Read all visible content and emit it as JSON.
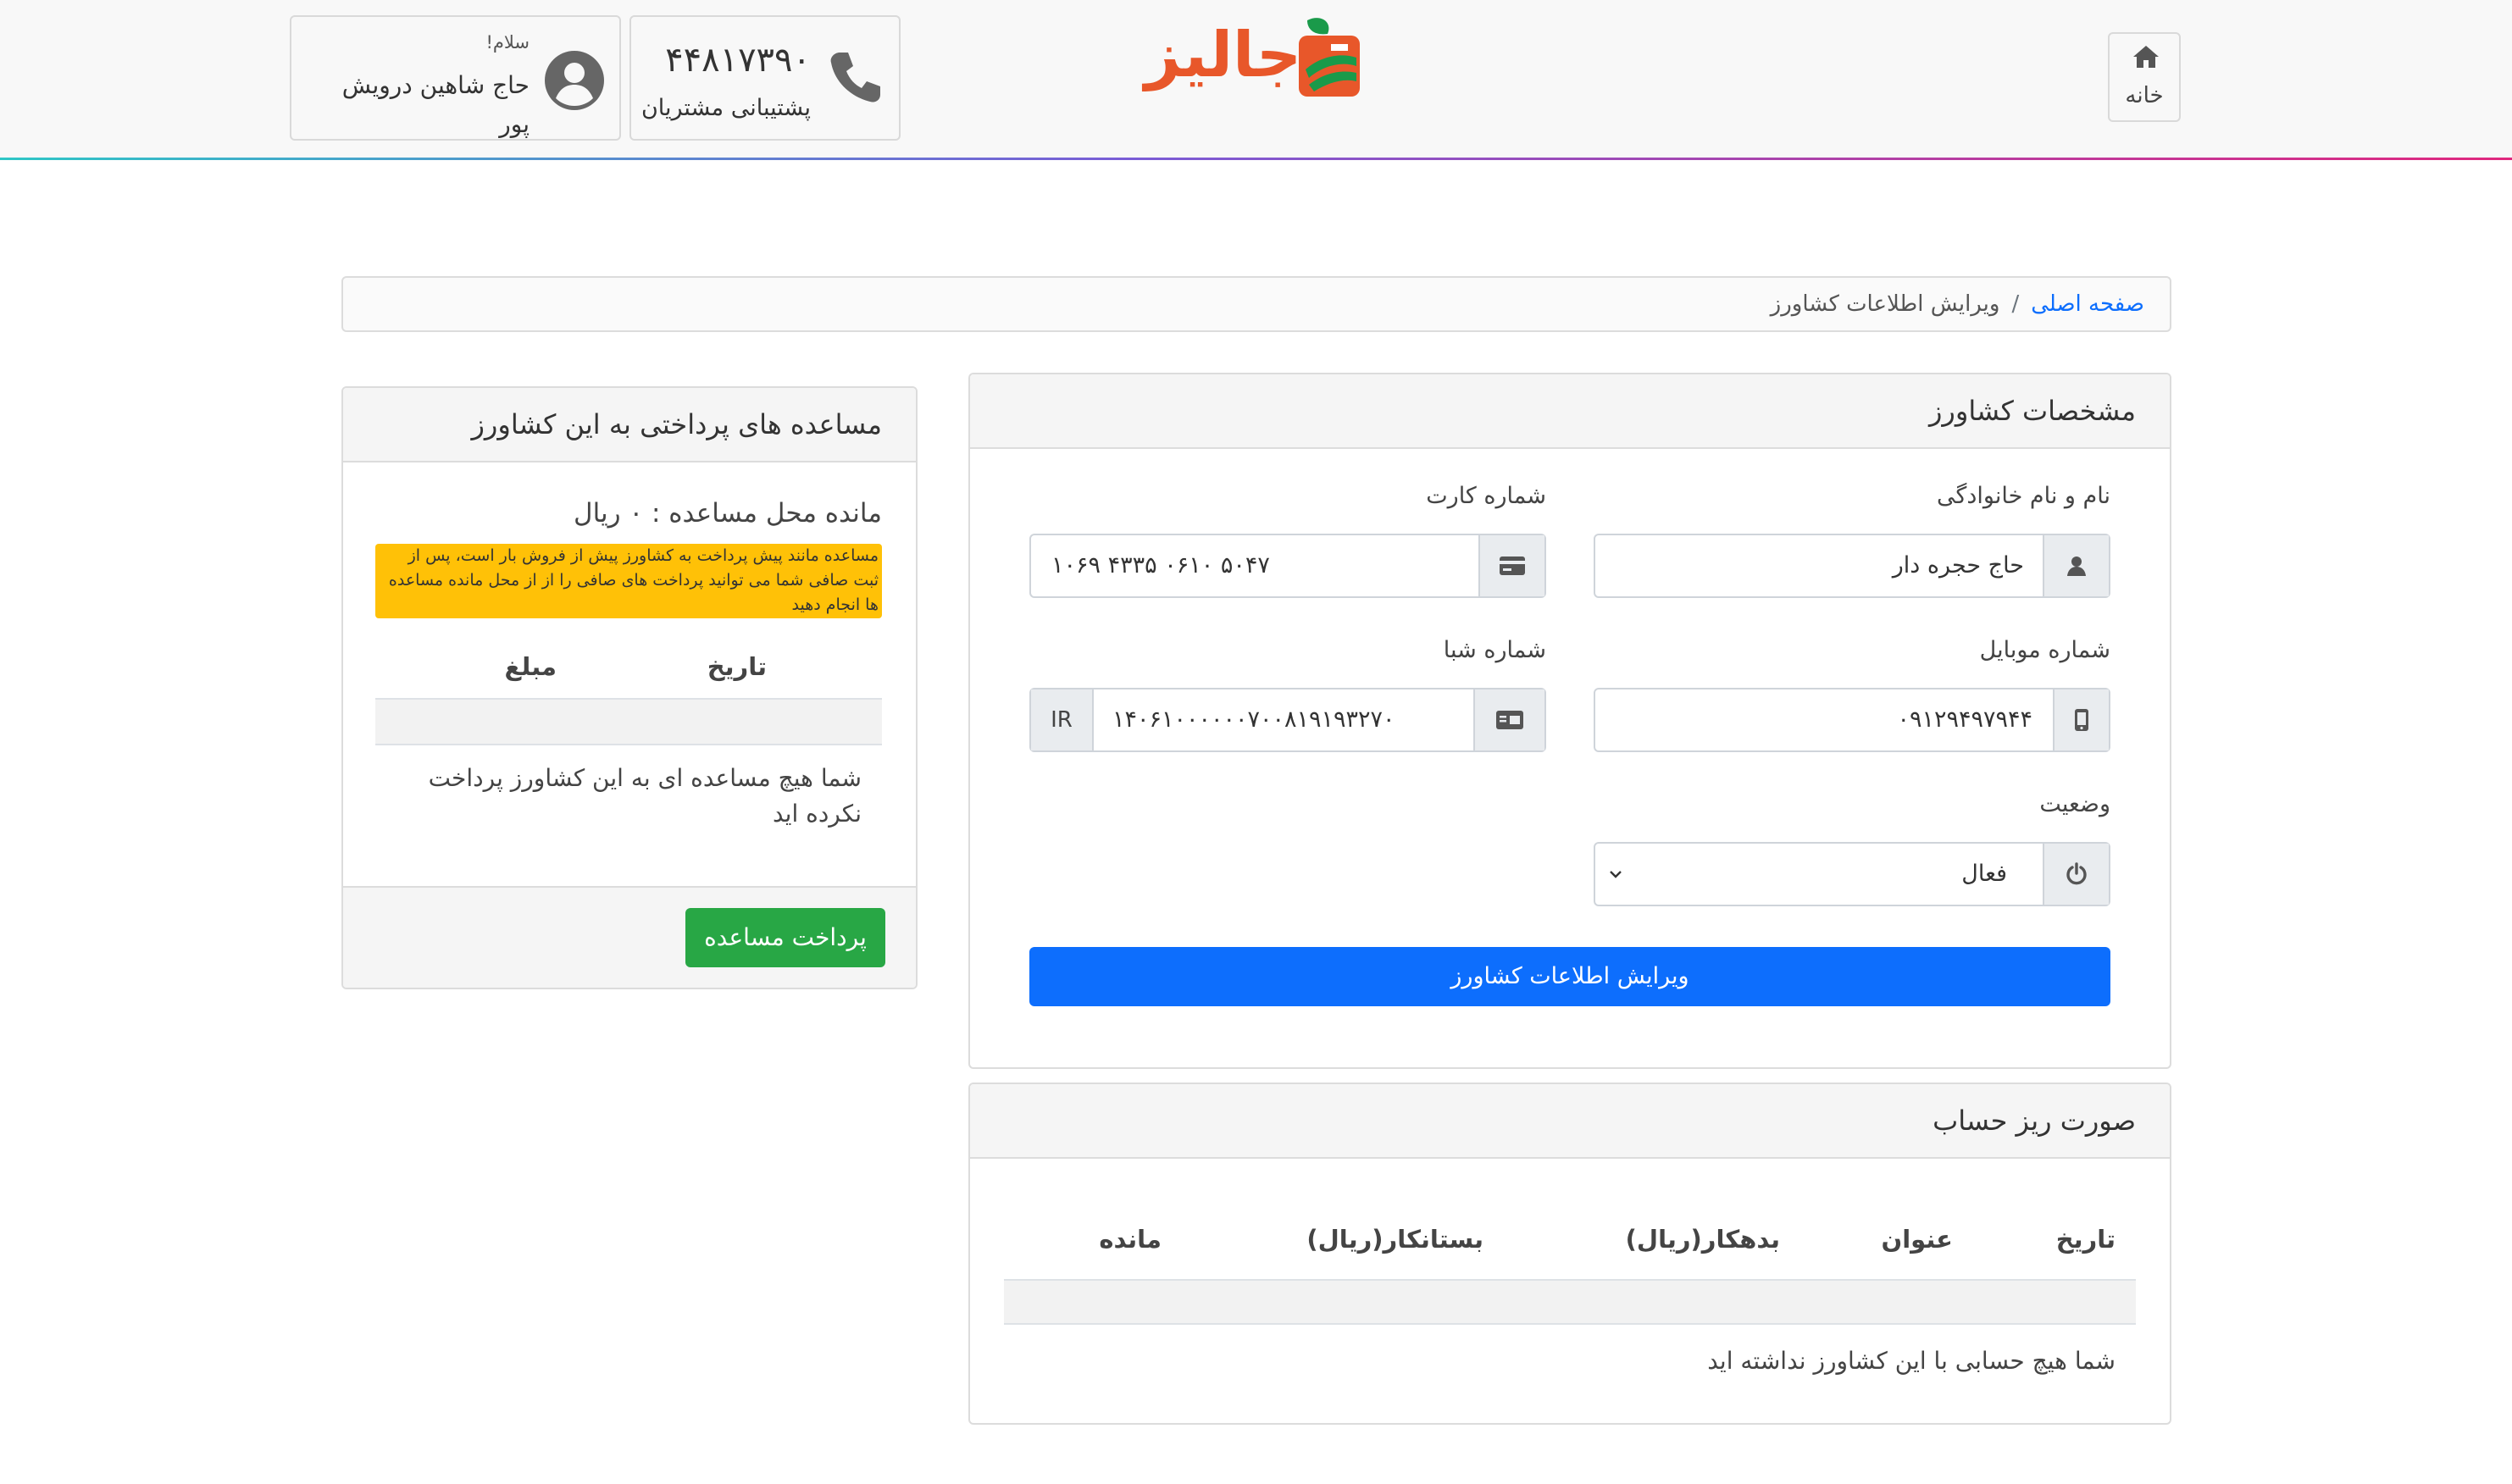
{
  "header": {
    "home_label": "خانه",
    "logo_text": "جالیز",
    "support": {
      "number": "۴۴۸۱۷۳۹۰",
      "label": "پشتیبانی مشتریان"
    },
    "user": {
      "greeting": "سلام!",
      "name": "حاج شاهین درویش پور"
    }
  },
  "breadcrumb": {
    "home": "صفحه اصلی",
    "separator": "/",
    "current": "ویرایش اطلاعات کشاورز"
  },
  "farmer_card": {
    "title": "مشخصات کشاورز",
    "name_label": "نام و نام خانوادگی",
    "name_value": "حاج حجره دار",
    "card_label": "شماره کارت",
    "card_value": "۵۰۴۷ ۰۶۱۰ ۴۳۳۵ ۱۰۶۹",
    "mobile_label": "شماره موبایل",
    "mobile_value": "۰۹۱۲۹۴۹۷۹۴۴",
    "sheba_label": "شماره شبا",
    "sheba_prefix": "IR",
    "sheba_value": "۱۴۰۶۱۰۰۰۰۰۰۷۰۰۸۱۹۱۹۳۲۷۰",
    "status_label": "وضعیت",
    "status_value": "فعال",
    "submit_label": "ویرایش اطلاعات کشاورز"
  },
  "statement_card": {
    "title": "صورت ریز حساب",
    "columns": [
      "تاریخ",
      "عنوان",
      "بدهکار(ریال)",
      "بستانکار(ریال)",
      "مانده"
    ],
    "empty_message": "شما هیچ حسابی با این کشاورز نداشته اید"
  },
  "payments_card": {
    "title": "مساعده های پرداختی به این کشاورز",
    "balance": "مانده محل مساعده : ۰ ریال",
    "alert": "مساعده مانند پیش پرداخت به کشاورز پیش از فروش بار است، پس از ثبت صافی شما می توانید پرداخت های صافی را از از محل مانده مساعده ها انجام دهید",
    "columns": [
      "تاریخ",
      "مبلغ"
    ],
    "empty_message": "شما هیچ مساعده ای به این کشاورز پرداخت نکرده اید",
    "pay_button": "پرداخت مساعده"
  },
  "colors": {
    "primary": "#0d6efd",
    "success": "#28a745",
    "warning": "#ffc107",
    "logo_orange": "#e8572a",
    "logo_green": "#1a9a4a"
  }
}
